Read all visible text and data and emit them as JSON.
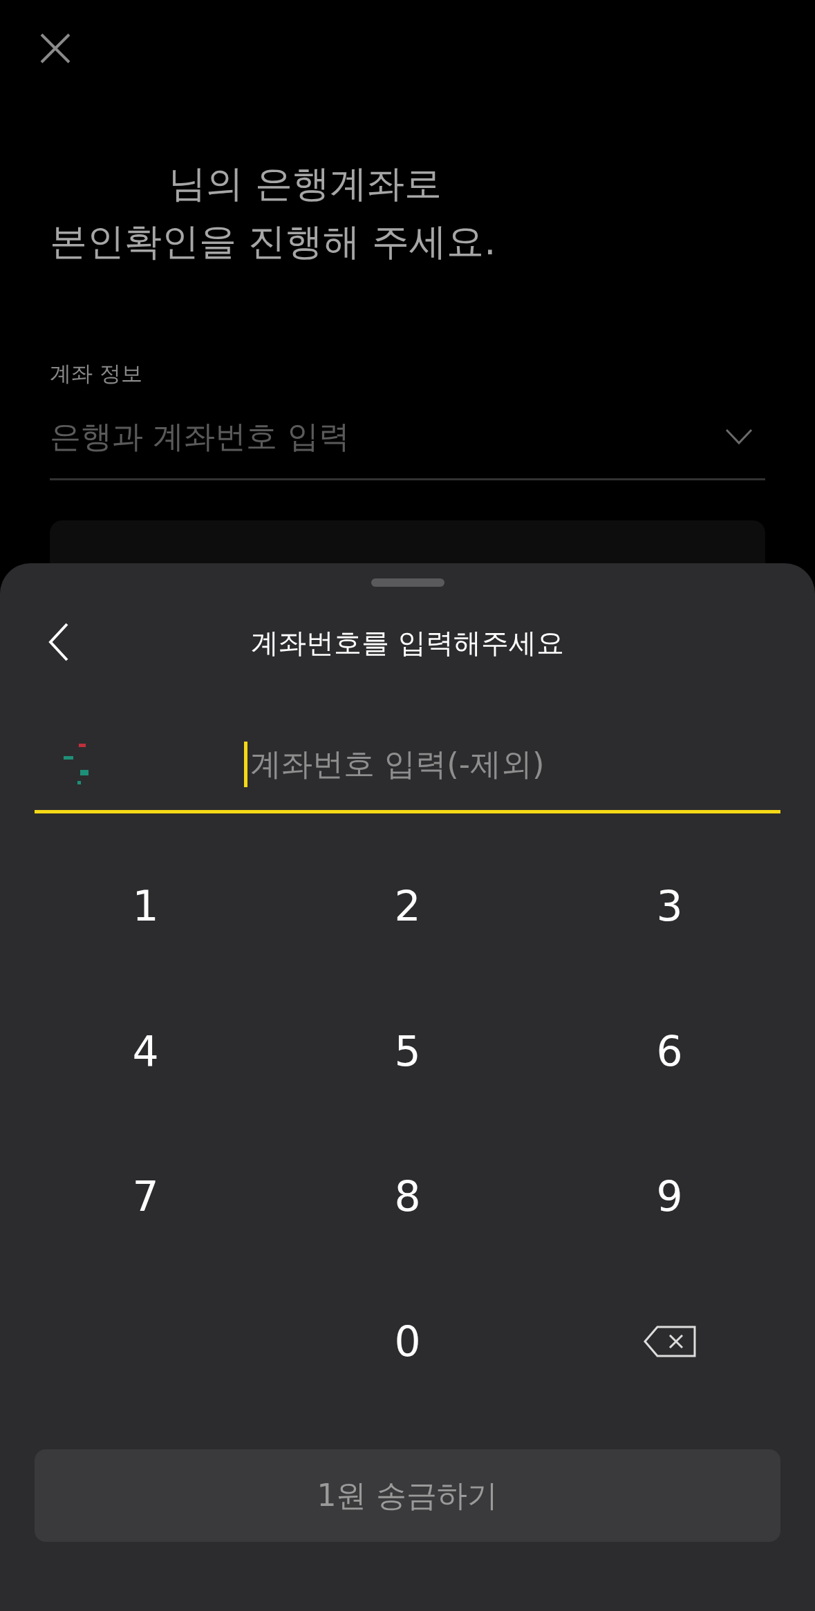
{
  "background": {
    "heading_lines": [
      "님의 은행계좌로",
      "본인확인을 진행해 주세요."
    ],
    "field_label": "계좌 정보",
    "field_placeholder": "은행과 계좌번호 입력"
  },
  "sheet": {
    "title": "계좌번호를 입력해주세요",
    "account_placeholder": "계좌번호 입력(-제외)",
    "keys": [
      {
        "kind": "digit",
        "label": "1"
      },
      {
        "kind": "digit",
        "label": "2"
      },
      {
        "kind": "digit",
        "label": "3"
      },
      {
        "kind": "digit",
        "label": "4"
      },
      {
        "kind": "digit",
        "label": "5"
      },
      {
        "kind": "digit",
        "label": "6"
      },
      {
        "kind": "digit",
        "label": "7"
      },
      {
        "kind": "digit",
        "label": "8"
      },
      {
        "kind": "digit",
        "label": "9"
      },
      {
        "kind": "blank"
      },
      {
        "kind": "digit",
        "label": "0"
      },
      {
        "kind": "backspace"
      }
    ],
    "submit": {
      "label": "1원 송금하기",
      "disabled": true
    }
  }
}
